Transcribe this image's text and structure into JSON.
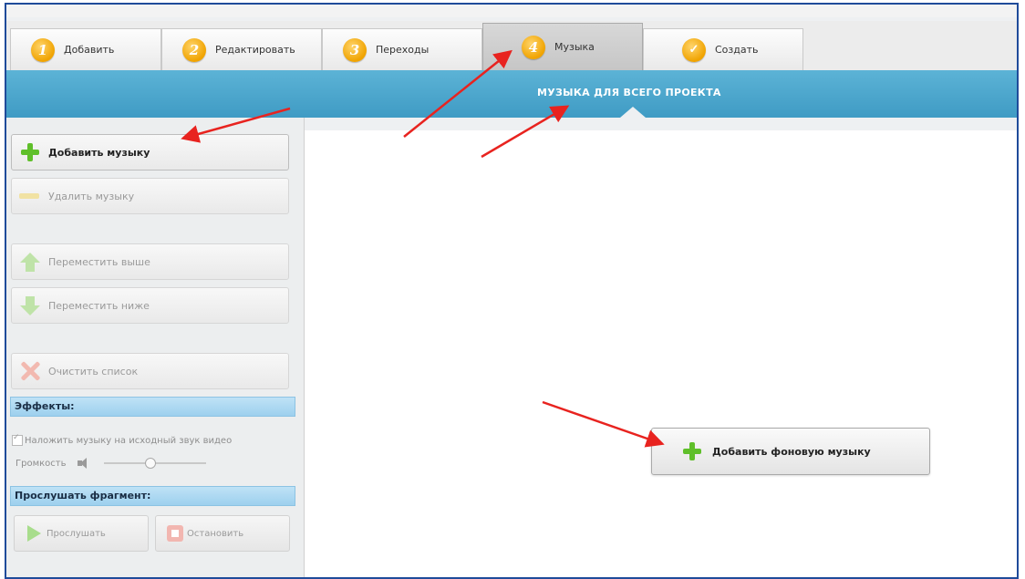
{
  "menubar": {
    "items": [
      "",
      "",
      "",
      "",
      ""
    ]
  },
  "tabs": [
    {
      "num": "1",
      "label": "Добавить"
    },
    {
      "num": "2",
      "label": "Редактировать"
    },
    {
      "num": "3",
      "label": "Переходы"
    },
    {
      "num": "4",
      "label": "Музыка"
    },
    {
      "num": "✓",
      "label": "Создать"
    }
  ],
  "header": {
    "title": "МУЗЫКА ДЛЯ ВСЕГО ПРОЕКТА"
  },
  "sidebar": {
    "add_music": "Добавить музыку",
    "remove_music": "Удалить музыку",
    "move_up": "Переместить выше",
    "move_down": "Переместить ниже",
    "clear_list": "Очистить список",
    "effects_header": "Эффекты:",
    "overlay_label": "Наложить музыку на исходный звук видео",
    "volume_label": "Громкость",
    "volume_level": 0.45,
    "preview_header": "Прослушать фрагмент:",
    "play_label": "Прослушать",
    "stop_label": "Остановить"
  },
  "main": {
    "add_bg_music": "Добавить фоновую музыку"
  },
  "colors": {
    "header_blue": "#4aa8cf",
    "annotation_red": "#e8231f",
    "plus_green": "#5fbf2a",
    "tab_orange": "#f0a300"
  },
  "icons": [
    "plus-icon",
    "minus-icon",
    "arrow-up-icon",
    "arrow-down-icon",
    "cross-icon",
    "speaker-icon",
    "play-icon",
    "stop-icon",
    "check-icon"
  ]
}
